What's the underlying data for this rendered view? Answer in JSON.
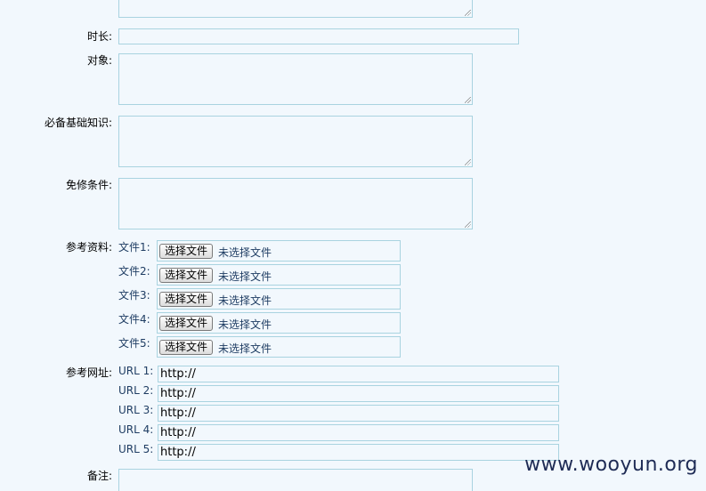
{
  "form": {
    "duration_label": "时长:",
    "audience_label": "对象:",
    "prerequisites_label": "必备基础知识:",
    "exemption_label": "免修条件:",
    "references_label": "参考资料:",
    "ref_urls_label": "参考网址:",
    "notes_label": "备注:",
    "files": [
      {
        "label": "文件1:",
        "button": "选择文件",
        "status": "未选择文件"
      },
      {
        "label": "文件2:",
        "button": "选择文件",
        "status": "未选择文件"
      },
      {
        "label": "文件3:",
        "button": "选择文件",
        "status": "未选择文件"
      },
      {
        "label": "文件4:",
        "button": "选择文件",
        "status": "未选择文件"
      },
      {
        "label": "文件5:",
        "button": "选择文件",
        "status": "未选择文件"
      }
    ],
    "urls": [
      {
        "label": "URL 1:",
        "value": "http://"
      },
      {
        "label": "URL 2:",
        "value": "http://"
      },
      {
        "label": "URL 3:",
        "value": "http://"
      },
      {
        "label": "URL 4:",
        "value": "http://"
      },
      {
        "label": "URL 5:",
        "value": "http://"
      }
    ]
  },
  "watermark": "www.wooyun.org"
}
